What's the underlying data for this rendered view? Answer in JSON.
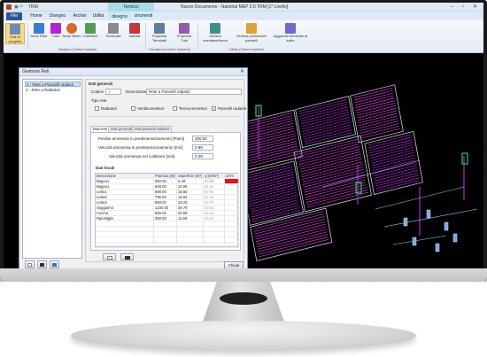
{
  "window": {
    "app_short": "TRM",
    "title": "Nuovo Documento - Namirial MEP 2.0 TRM [1° Livello]",
    "context_tab": "Termico",
    "controls": "– ▫ ✕"
  },
  "tabs": [
    {
      "label": "File"
    },
    {
      "label": "Home"
    },
    {
      "label": "Disegno"
    },
    {
      "label": "Archivi"
    },
    {
      "label": "Utilità"
    },
    {
      "label": "disegno"
    },
    {
      "label": "strumenti"
    }
  ],
  "ribbon": {
    "buttons": [
      {
        "label": "Dati di progetto",
        "icon": "project-data-icon"
      },
      {
        "label": "Inizio Rete",
        "icon": "network-start-icon"
      },
      {
        "label": "Tubo",
        "icon": "pipe-icon"
      },
      {
        "label": "Nodo fittizio",
        "icon": "node-icon"
      },
      {
        "label": "Collettore",
        "icon": "manifold-icon"
      },
      {
        "label": "Terminale",
        "icon": "terminal-icon"
      },
      {
        "label": "Valvola",
        "icon": "valve-icon"
      },
      {
        "label": "Proprietà Terminali",
        "icon": "terminal-props-icon"
      },
      {
        "label": "Proprietà Tubi",
        "icon": "pipe-props-icon"
      },
      {
        "label": "Genera mandata/ritorno",
        "icon": "generate-icon"
      },
      {
        "label": "Verifica preliminare pannelli",
        "icon": "verify-icon"
      },
      {
        "label": "Aggancia terminale al tratto",
        "icon": "attach-icon"
      }
    ],
    "groups": [
      {
        "label": "Disegno (Clima impianti)"
      },
      {
        "label": "Visualizza (Clima impianti)"
      },
      {
        "label": "Utility (Clima impianti)"
      }
    ]
  },
  "dialog": {
    "title": "Gestione Reti",
    "tree": [
      {
        "label": "1 - Rete a Pannelli radianti"
      },
      {
        "label": "2 - Rete a Radiatori"
      }
    ],
    "general": {
      "section": "Dati generali",
      "code_label": "Codice",
      "code_value": "1",
      "desc_label": "Descrizione",
      "desc_value": "Rete a Pannelli radianti",
      "type_label": "Tipo rete",
      "types": [
        {
          "label": "Radiatori",
          "checked": false
        },
        {
          "label": "Ventilconvettori",
          "checked": false
        },
        {
          "label": "Termoconvettori",
          "checked": false
        },
        {
          "label": "Pannelli radianti",
          "checked": true
        }
      ]
    },
    "subtabs": [
      {
        "label": "Dati rete"
      },
      {
        "label": "Dati generali"
      },
      {
        "label": "Dati pannelli radianti"
      }
    ],
    "net": {
      "params": [
        {
          "label": "Perdite ammesse in predimensionamento [Pa/m]",
          "value": "200.00"
        },
        {
          "label": "Velocità ammessa in predimensionamento [m/s]",
          "value": "0.90"
        },
        {
          "label": "Velocità ammessa nel collettore [m/s]",
          "value": "0.30"
        }
      ],
      "rooms_label": "Dati locali",
      "columns": [
        "Descrizione",
        "Potenza [W]",
        "Superficie [m²]",
        "q [W/m²]",
        "ΔTm"
      ],
      "rows": [
        {
          "name": "Bagno1",
          "power": "550.00",
          "surface": "6.48",
          "q": "84.88",
          "flag": true
        },
        {
          "name": "Bagno1",
          "power": "620.00",
          "surface": "10.08",
          "q": "61.51",
          "flag": false
        },
        {
          "name": "Letto1",
          "power": "890.00",
          "surface": "15.60",
          "q": "57.05",
          "flag": false
        },
        {
          "name": "Letto2",
          "power": "796.00",
          "surface": "15.54",
          "q": "51.22",
          "flag": false
        },
        {
          "name": "Letto3",
          "power": "850.00",
          "surface": "18.20",
          "q": "46.70",
          "flag": false
        },
        {
          "name": "Soggiorno",
          "power": "1230.00",
          "surface": "39.79",
          "q": "30.91",
          "flag": false
        },
        {
          "name": "Cucina",
          "power": "950.00",
          "surface": "20.59",
          "q": "46.13",
          "flag": false
        },
        {
          "name": "Ripostiglio",
          "power": "350.00",
          "surface": "11.58",
          "q": "30.22",
          "flag": false
        }
      ]
    },
    "close_label": "Chiudi"
  },
  "colors": {
    "cad_background": "#000000",
    "pipe_primary": "#b024d6",
    "pipe_secondary": "#d43ad8",
    "wall": "#c8c8d8",
    "riser": "#2bd14a",
    "alert": "#e01515"
  }
}
